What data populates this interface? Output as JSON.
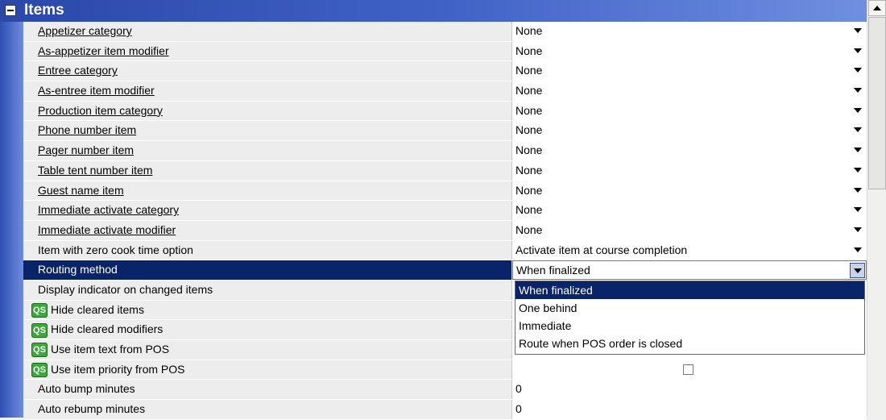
{
  "section": {
    "title": "Items"
  },
  "rows": [
    {
      "label": "Appetizer category",
      "value": "None",
      "link": true,
      "qs": false,
      "dropdown": true
    },
    {
      "label": "As-appetizer item modifier",
      "value": "None",
      "link": true,
      "qs": false,
      "dropdown": true
    },
    {
      "label": "Entree category",
      "value": "None",
      "link": true,
      "qs": false,
      "dropdown": true
    },
    {
      "label": "As-entree item modifier",
      "value": "None",
      "link": true,
      "qs": false,
      "dropdown": true
    },
    {
      "label": "Production item category",
      "value": "None",
      "link": true,
      "qs": false,
      "dropdown": true
    },
    {
      "label": "Phone number item",
      "value": "None",
      "link": true,
      "qs": false,
      "dropdown": true
    },
    {
      "label": "Pager number item",
      "value": "None",
      "link": true,
      "qs": false,
      "dropdown": true
    },
    {
      "label": "Table tent number item",
      "value": "None",
      "link": true,
      "qs": false,
      "dropdown": true
    },
    {
      "label": "Guest name item",
      "value": "None",
      "link": true,
      "qs": false,
      "dropdown": true
    },
    {
      "label": "Immediate activate category",
      "value": "None",
      "link": true,
      "qs": false,
      "dropdown": true
    },
    {
      "label": "Immediate activate modifier",
      "value": "None",
      "link": true,
      "qs": false,
      "dropdown": true
    },
    {
      "label": "Item with zero cook time option",
      "value": "Activate item at course completion",
      "link": false,
      "qs": false,
      "dropdown": true
    },
    {
      "label": "Routing method",
      "value": "When finalized",
      "link": false,
      "qs": false,
      "dropdown": true,
      "selected": true
    },
    {
      "label": "Display indicator on changed items",
      "value": "",
      "link": false,
      "qs": false,
      "dropdown": false
    },
    {
      "label": "Hide cleared items",
      "value": "",
      "link": false,
      "qs": true,
      "dropdown": false
    },
    {
      "label": "Hide cleared modifiers",
      "value": "",
      "link": false,
      "qs": true,
      "dropdown": false
    },
    {
      "label": "Use item text from POS",
      "value": "",
      "link": false,
      "qs": true,
      "dropdown": false
    },
    {
      "label": "Use item priority from POS",
      "value": "",
      "link": false,
      "qs": true,
      "dropdown": false,
      "checkbox": true
    },
    {
      "label": "Auto bump minutes",
      "value": "0",
      "link": false,
      "qs": false,
      "dropdown": false
    },
    {
      "label": "Auto rebump minutes",
      "value": "0",
      "link": false,
      "qs": false,
      "dropdown": false
    }
  ],
  "qs_badge": "QS",
  "routing_options": [
    "When finalized",
    "One behind",
    "Immediate",
    "Route when POS order is closed"
  ],
  "routing_selected_index": 0
}
